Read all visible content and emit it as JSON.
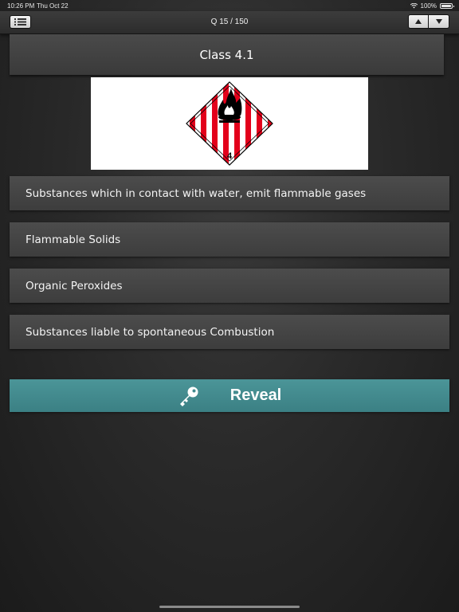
{
  "status_bar": {
    "time": "10:26 PM",
    "date": "Thu Oct 22",
    "battery": "100%"
  },
  "nav": {
    "counter": "Q 15 / 150",
    "menu_icon": "list-icon",
    "up_icon": "arrow-up-icon",
    "down_icon": "arrow-down-icon"
  },
  "question": {
    "title": "Class 4.1",
    "image": {
      "icon": "flammable-solid-hazard-diamond",
      "number": "4",
      "colors": {
        "stripe": "#e3001b",
        "background": "#ffffff",
        "symbol": "#000000"
      }
    }
  },
  "answers": [
    {
      "label": "Substances which in contact with water, emit flammable gases"
    },
    {
      "label": "Flammable Solids"
    },
    {
      "label": "Organic Peroxides"
    },
    {
      "label": "Substances liable to spontaneous Combustion"
    }
  ],
  "reveal": {
    "label": "Reveal",
    "icon": "key-icon",
    "color": "#428a8e"
  }
}
